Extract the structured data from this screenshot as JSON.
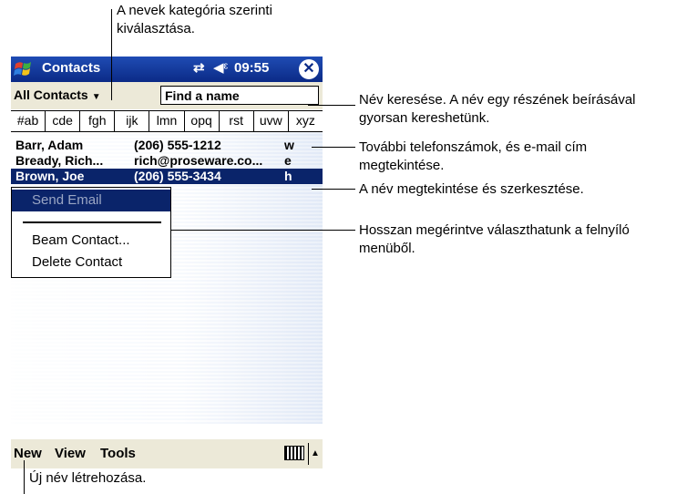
{
  "titlebar": {
    "app_title": "Contacts",
    "time": "09:55",
    "connectivity_glyph": "⇄",
    "volume_glyph": "◀ᵋ",
    "close_glyph": "✕"
  },
  "category": {
    "selected": "All Contacts",
    "find_placeholder": "Find a name"
  },
  "tabs": [
    "#ab",
    "cde",
    "fgh",
    "ijk",
    "lmn",
    "opq",
    "rst",
    "uvw",
    "xyz"
  ],
  "contacts": [
    {
      "name": "Barr, Adam",
      "info": "(206) 555-1212",
      "type": "w"
    },
    {
      "name": "Bready, Rich...",
      "info": "rich@proseware.co...",
      "type": "e"
    },
    {
      "name": "Brown, Joe",
      "info": "(206) 555-3434",
      "type": "h"
    }
  ],
  "popup_menu": [
    "Send Email",
    "Beam Contact...",
    "Delete Contact"
  ],
  "menubar": {
    "new": "New",
    "view": "View",
    "tools": "Tools",
    "kbd_arrow": "▲"
  },
  "annotations": {
    "category": "A nevek kategória szerinti kiválasztása.",
    "find": "Név keresése. A név egy részének beírásával gyorsan kereshetünk.",
    "more_numbers": "További telefonszámok, és e-mail cím megtekintése.",
    "view_edit": "A név megtekintése és szerkesztése.",
    "popup": "Hosszan megérintve választhatunk a felnyíló menüből.",
    "new": "Új név létrehozása."
  },
  "colors": {
    "titlebar": "#0b2a86",
    "selection": "#0a246a",
    "bars": "#ece9d8"
  },
  "icons": {
    "start": "windows-flag-icon",
    "keyboard": "keyboard-icon"
  }
}
